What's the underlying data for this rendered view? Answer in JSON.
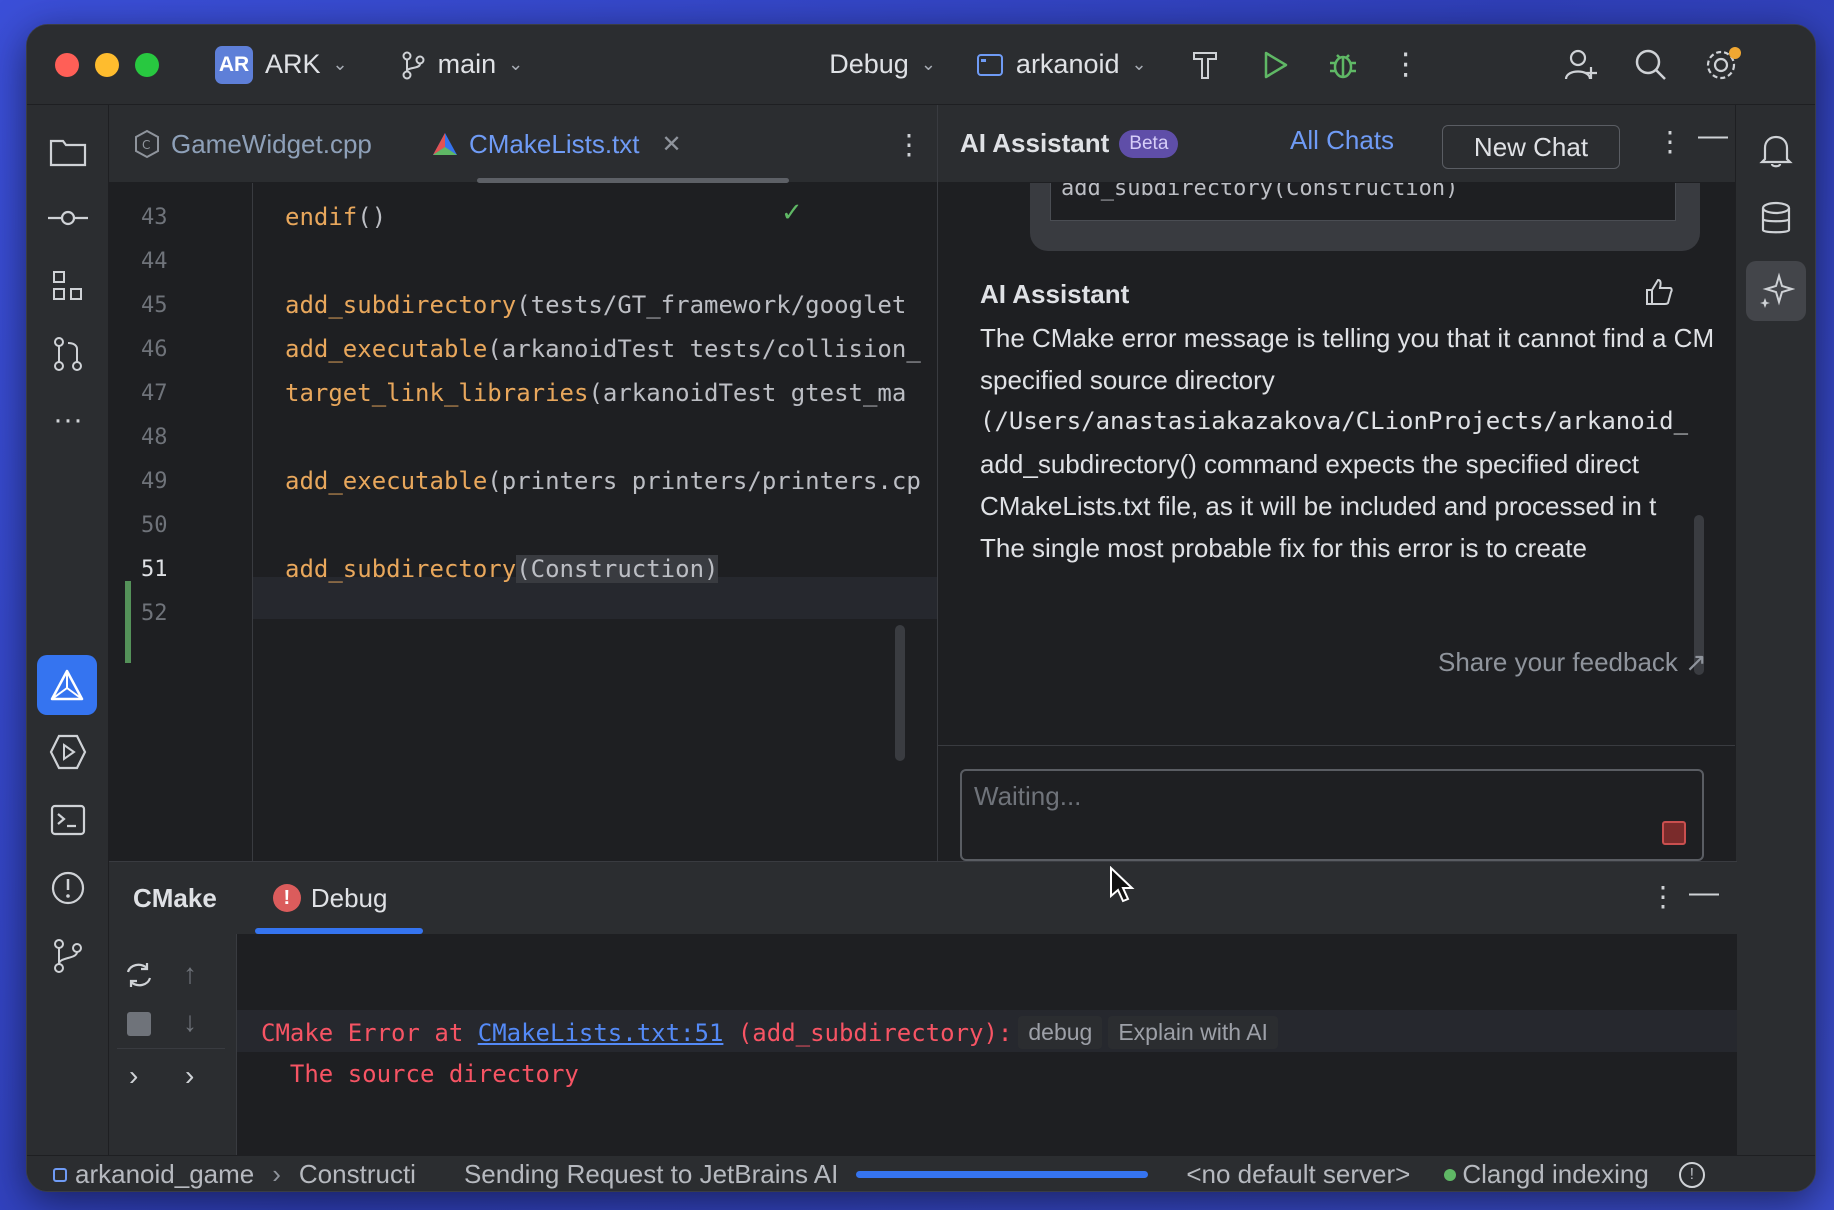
{
  "titlebar": {
    "project_badge": "AR",
    "project_name": "ARK",
    "branch": "main",
    "config": "Debug",
    "run_target": "arkanoid"
  },
  "editor": {
    "tabs": [
      {
        "label": "GameWidget.cpp"
      },
      {
        "label": "CMakeLists.txt"
      }
    ],
    "lines": [
      {
        "num": "43",
        "kw": "endif",
        "rest": "()"
      },
      {
        "num": "44",
        "kw": "",
        "rest": ""
      },
      {
        "num": "45",
        "kw": "add_subdirectory",
        "rest": "(tests/GT_framework/googlet"
      },
      {
        "num": "46",
        "kw": "add_executable",
        "rest": "(arkanoidTest tests/collision_"
      },
      {
        "num": "47",
        "kw": "target_link_libraries",
        "rest": "(arkanoidTest gtest_ma"
      },
      {
        "num": "48",
        "kw": "",
        "rest": ""
      },
      {
        "num": "49",
        "kw": "add_executable",
        "rest": "(printers printers/printers.cp"
      },
      {
        "num": "50",
        "kw": "",
        "rest": ""
      },
      {
        "num": "51",
        "kw": "add_subdirectory",
        "rest": "(Construction)"
      },
      {
        "num": "52",
        "kw": "",
        "rest": ""
      }
    ]
  },
  "ai": {
    "title": "AI Assistant",
    "beta": "Beta",
    "all_chats": "All Chats",
    "new_chat": "New Chat",
    "user_snippet": "add_subdirectory(Construction)",
    "response_author": "AI Assistant",
    "response_lines": [
      "The CMake error message is telling you that it cannot find a CM",
      "specified source directory",
      "(/Users/anastasiakazakova/CLionProjects/arkanoid_",
      "add_subdirectory() command expects the specified direct",
      "CMakeLists.txt file, as it will be included and processed in t",
      "The single most probable fix for this error is to create"
    ],
    "feedback": "Share your feedback ↗",
    "input_placeholder": "Waiting..."
  },
  "bottom": {
    "tab_cmake": "CMake",
    "tab_debug": "Debug",
    "err_prefix": "CMake Error at ",
    "err_link": "CMakeLists.txt:51",
    "err_suffix": " (add_subdirectory):",
    "chip_debug": "debug",
    "chip_explain": "Explain with AI",
    "err_line2": "  The source directory"
  },
  "status": {
    "project": "arkanoid_game",
    "folder": "Constructi",
    "task": "Sending Request to JetBrains AI",
    "progress": 1.0,
    "server": "<no default server>",
    "indexing": "Clangd indexing"
  },
  "colors": {
    "accent": "#3574f0",
    "error": "#f75464",
    "keyword": "#e8a75c"
  }
}
